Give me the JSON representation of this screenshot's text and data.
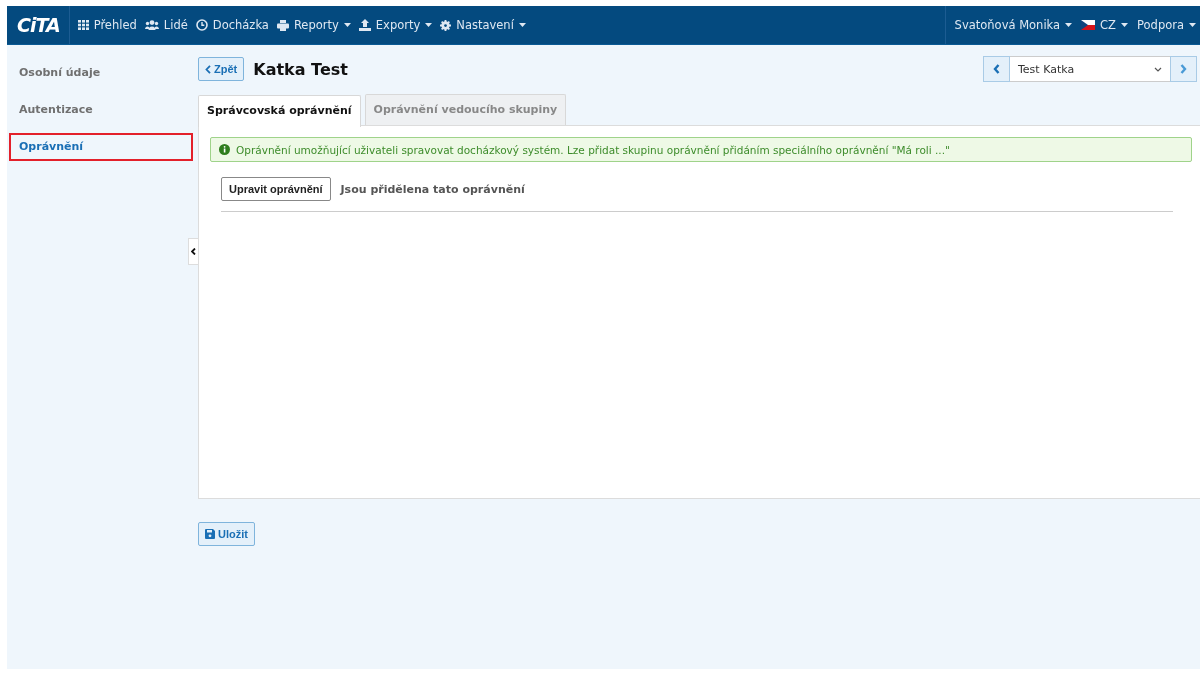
{
  "navbar": {
    "logo": "CiTA",
    "items": [
      {
        "kind": "grid",
        "label": "Přehled",
        "dropdown": false
      },
      {
        "kind": "people",
        "label": "Lidé",
        "dropdown": false
      },
      {
        "kind": "clock",
        "label": "Docházka",
        "dropdown": false
      },
      {
        "kind": "print",
        "label": "Reporty",
        "dropdown": true
      },
      {
        "kind": "export",
        "label": "Exporty",
        "dropdown": true
      },
      {
        "kind": "gear",
        "label": "Nastavení",
        "dropdown": true
      }
    ],
    "right_items": [
      {
        "kind": "user",
        "label": "Svatoňová Monika",
        "dropdown": true
      },
      {
        "kind": "flag",
        "label": "CZ",
        "dropdown": true
      },
      {
        "kind": "plain",
        "label": "Podpora",
        "dropdown": true
      }
    ]
  },
  "sidebar": {
    "items": [
      {
        "label": "Osobní údaje",
        "selected": false,
        "highlighted": false
      },
      {
        "label": "Autentizace",
        "selected": false,
        "highlighted": false
      },
      {
        "label": "Oprávnění",
        "selected": true,
        "highlighted": true
      }
    ]
  },
  "header": {
    "back_button": "Zpět",
    "title": "Katka Test",
    "person_select": {
      "value": "Test Katka"
    }
  },
  "tabs": [
    {
      "label": "Správcovská oprávnění",
      "selected": true
    },
    {
      "label": "Oprávnění vedoucího skupiny",
      "selected": false
    }
  ],
  "alert": "Oprávnění umožňující uživateli spravovat docházkový systém. Lze přidat skupinu oprávnění přidáním speciálního oprávnění \"Má roli ...\"",
  "edit_button": "Upravit oprávnění",
  "assigned_label": "Jsou přidělena tato oprávnění",
  "save_button": "Uložit"
}
